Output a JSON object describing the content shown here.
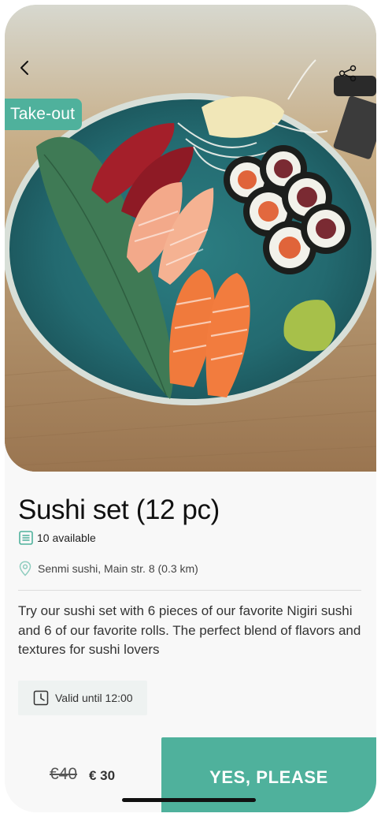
{
  "hero": {
    "badge": "Take-out",
    "back_icon": "chevron-left-icon",
    "share_icon": "share-icon"
  },
  "product": {
    "title": "Sushi set (12 pc)",
    "available": "10 available",
    "location": "Senmi sushi, Main str. 8 (0.3 km)",
    "description": "Try our sushi set with 6 pieces of our favorite Nigiri sushi and 6 of our favorite rolls. The perfect blend of flavors and textures for sushi lovers",
    "valid_until": "Valid until 12:00"
  },
  "pricing": {
    "old_price": "€40",
    "new_price": "€ 30"
  },
  "cta": {
    "label": "YES, PLEASE"
  },
  "colors": {
    "accent": "#4fb19c",
    "text": "#111111"
  }
}
